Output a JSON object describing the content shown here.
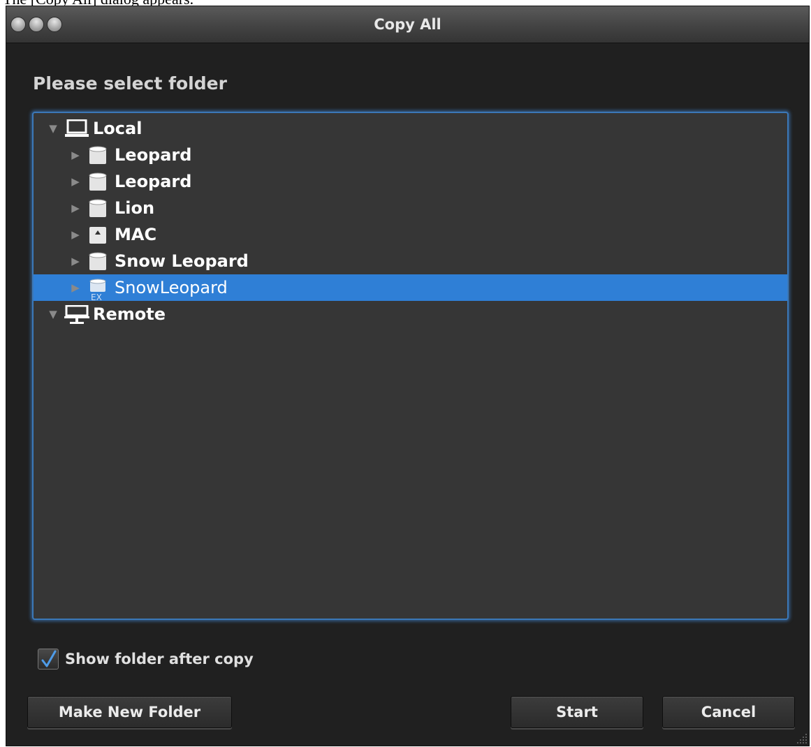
{
  "caption": "The [Copy All] dialog appears.",
  "window": {
    "title": "Copy All",
    "heading": "Please select folder"
  },
  "tree": {
    "root_local": {
      "label": "Local",
      "icon": "computer-icon",
      "expanded": true
    },
    "volumes": [
      {
        "label": "Leopard",
        "icon": "drive-icon"
      },
      {
        "label": "Leopard",
        "icon": "drive-icon"
      },
      {
        "label": "Lion",
        "icon": "drive-icon"
      },
      {
        "label": "MAC",
        "icon": "mac-volume-icon"
      },
      {
        "label": "Snow Leopard",
        "icon": "drive-icon"
      },
      {
        "label": "SnowLeopard",
        "icon": "external-drive-icon",
        "badge": "EX",
        "selected": true
      }
    ],
    "root_remote": {
      "label": "Remote",
      "icon": "network-icon",
      "expanded": true
    }
  },
  "options": {
    "show_folder_after_copy": {
      "label": "Show folder after copy",
      "checked": true
    }
  },
  "buttons": {
    "make_new_folder": "Make New Folder",
    "start": "Start",
    "cancel": "Cancel"
  },
  "colors": {
    "selection": "#2f7fd6",
    "focus_ring": "#3b78b8",
    "panel": "#363636",
    "window": "#202020"
  }
}
